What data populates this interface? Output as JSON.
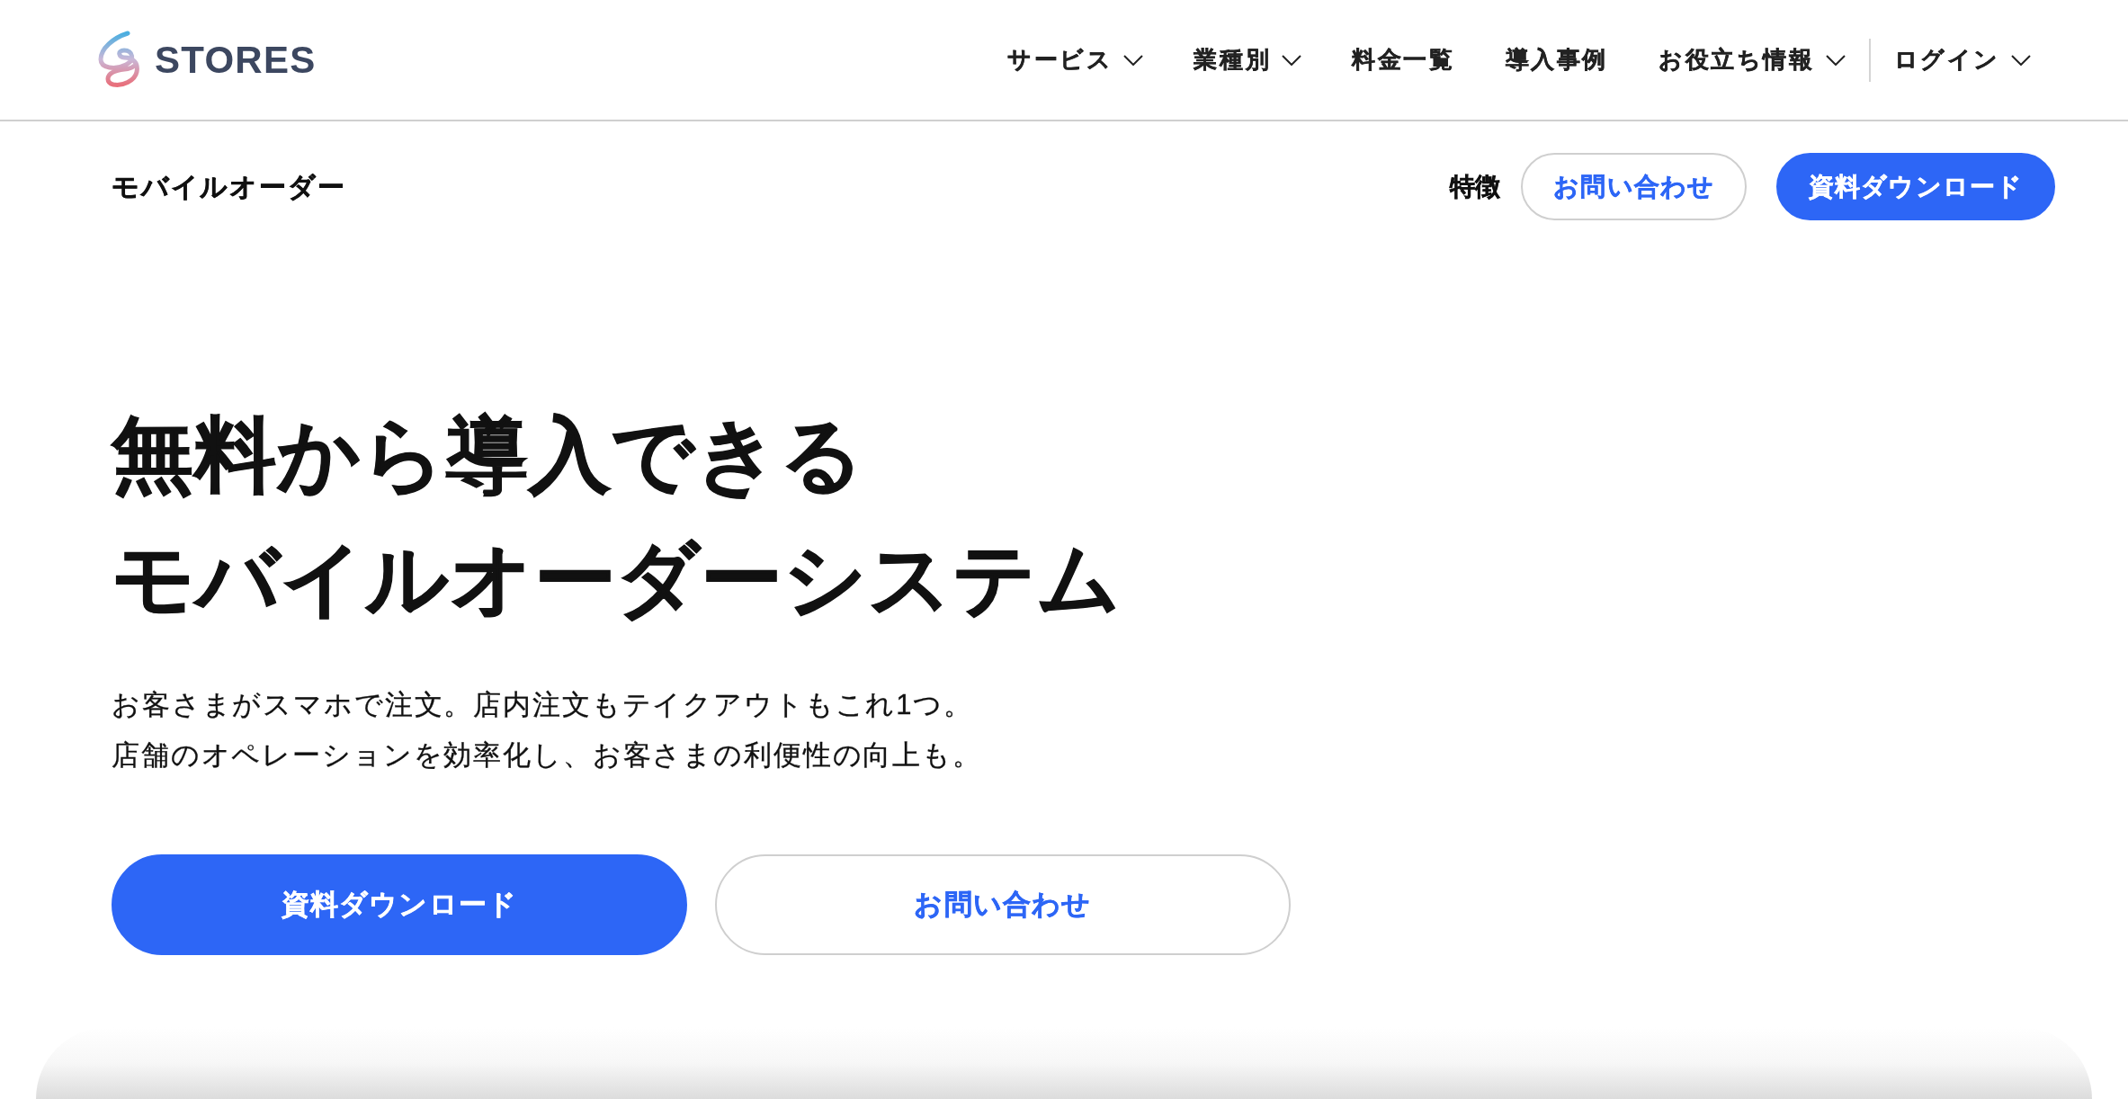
{
  "header": {
    "logo": {
      "text": "STORES"
    },
    "nav": [
      {
        "label": "サービス",
        "dropdown": true
      },
      {
        "label": "業種別",
        "dropdown": true
      },
      {
        "label": "料金一覧",
        "dropdown": false
      },
      {
        "label": "導入事例",
        "dropdown": false
      },
      {
        "label": "お役立ち情報",
        "dropdown": true
      }
    ],
    "login": {
      "label": "ログイン",
      "dropdown": true
    }
  },
  "subheader": {
    "title": "モバイルオーダー",
    "links": [
      {
        "label": "特徴"
      }
    ],
    "buttons": [
      {
        "label": "お問い合わせ",
        "kind": "outline"
      },
      {
        "label": "資料ダウンロード",
        "kind": "primary"
      }
    ]
  },
  "hero": {
    "title_lines": [
      "無料から導入できる",
      "モバイルオーダーシステム"
    ],
    "description_lines": [
      "お客さまがスマホで注文。店内注文もテイクアウトもこれ1つ。",
      "店舗のオペレーションを効率化し、お客さまの利便性の向上も。"
    ],
    "buttons": [
      {
        "label": "資料ダウンロード",
        "kind": "primary"
      },
      {
        "label": "お問い合わせ",
        "kind": "outline"
      }
    ]
  }
}
